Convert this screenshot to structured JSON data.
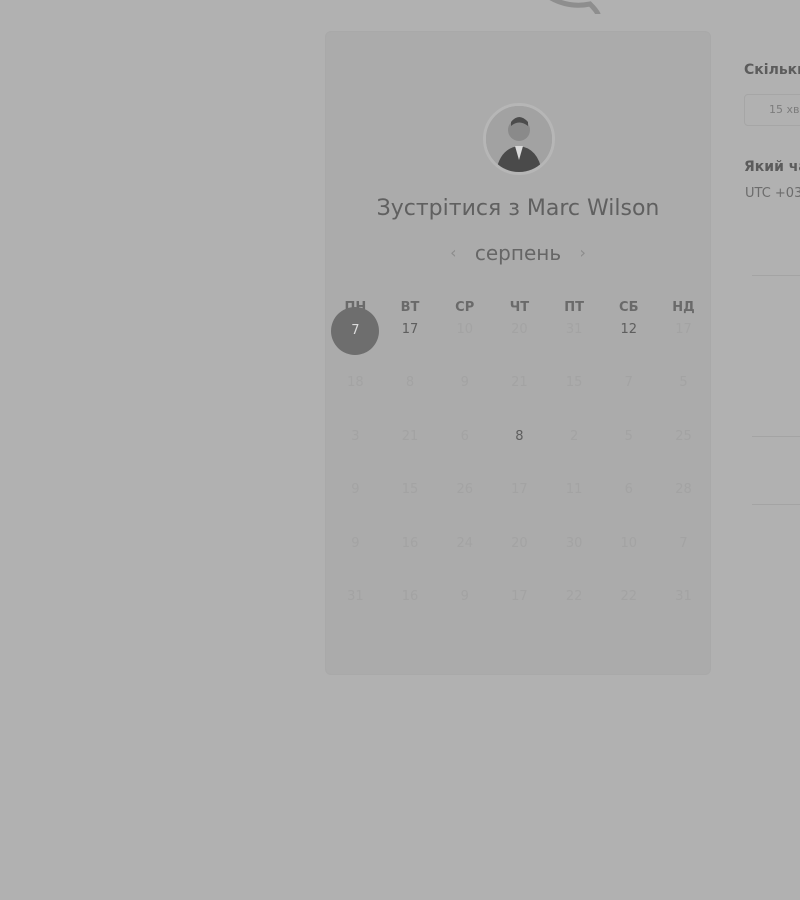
{
  "booking": {
    "title": "Зустрітися з Marc Wilson",
    "month": "серпень",
    "prev_arrow": "‹",
    "next_arrow": "›"
  },
  "calendar": {
    "weekdays": [
      "ПН",
      "ВТ",
      "СР",
      "ЧТ",
      "ПТ",
      "СБ",
      "НД"
    ],
    "weeks": [
      [
        {
          "d": "7",
          "state": "selected"
        },
        {
          "d": "17",
          "state": "available"
        },
        {
          "d": "10",
          "state": "disabled"
        },
        {
          "d": "20",
          "state": "disabled"
        },
        {
          "d": "31",
          "state": "disabled"
        },
        {
          "d": "12",
          "state": "available"
        },
        {
          "d": "17",
          "state": "disabled"
        }
      ],
      [
        {
          "d": "18",
          "state": "disabled"
        },
        {
          "d": "8",
          "state": "disabled"
        },
        {
          "d": "9",
          "state": "disabled"
        },
        {
          "d": "21",
          "state": "disabled"
        },
        {
          "d": "15",
          "state": "disabled"
        },
        {
          "d": "7",
          "state": "disabled"
        },
        {
          "d": "5",
          "state": "disabled"
        }
      ],
      [
        {
          "d": "3",
          "state": "disabled"
        },
        {
          "d": "21",
          "state": "disabled"
        },
        {
          "d": "6",
          "state": "disabled"
        },
        {
          "d": "8",
          "state": "available"
        },
        {
          "d": "2",
          "state": "disabled"
        },
        {
          "d": "5",
          "state": "disabled"
        },
        {
          "d": "25",
          "state": "disabled"
        }
      ],
      [
        {
          "d": "9",
          "state": "disabled"
        },
        {
          "d": "15",
          "state": "disabled"
        },
        {
          "d": "26",
          "state": "disabled"
        },
        {
          "d": "17",
          "state": "disabled"
        },
        {
          "d": "11",
          "state": "disabled"
        },
        {
          "d": "6",
          "state": "disabled"
        },
        {
          "d": "28",
          "state": "disabled"
        }
      ],
      [
        {
          "d": "9",
          "state": "disabled"
        },
        {
          "d": "16",
          "state": "disabled"
        },
        {
          "d": "24",
          "state": "disabled"
        },
        {
          "d": "20",
          "state": "disabled"
        },
        {
          "d": "30",
          "state": "disabled"
        },
        {
          "d": "10",
          "state": "disabled"
        },
        {
          "d": "7",
          "state": "disabled"
        }
      ],
      [
        {
          "d": "31",
          "state": "disabled"
        },
        {
          "d": "16",
          "state": "disabled"
        },
        {
          "d": "9",
          "state": "disabled"
        },
        {
          "d": "17",
          "state": "disabled"
        },
        {
          "d": "22",
          "state": "disabled"
        },
        {
          "d": "22",
          "state": "disabled"
        },
        {
          "d": "31",
          "state": "disabled"
        }
      ]
    ]
  },
  "details": {
    "duration_label": "Скільки",
    "duration_value": "15 хв",
    "time_label": "Який ча",
    "timezone": "UTC +03"
  },
  "colors": {
    "overlay_bg": "#b1b1b1",
    "selected_day": "#6e6e6e"
  }
}
